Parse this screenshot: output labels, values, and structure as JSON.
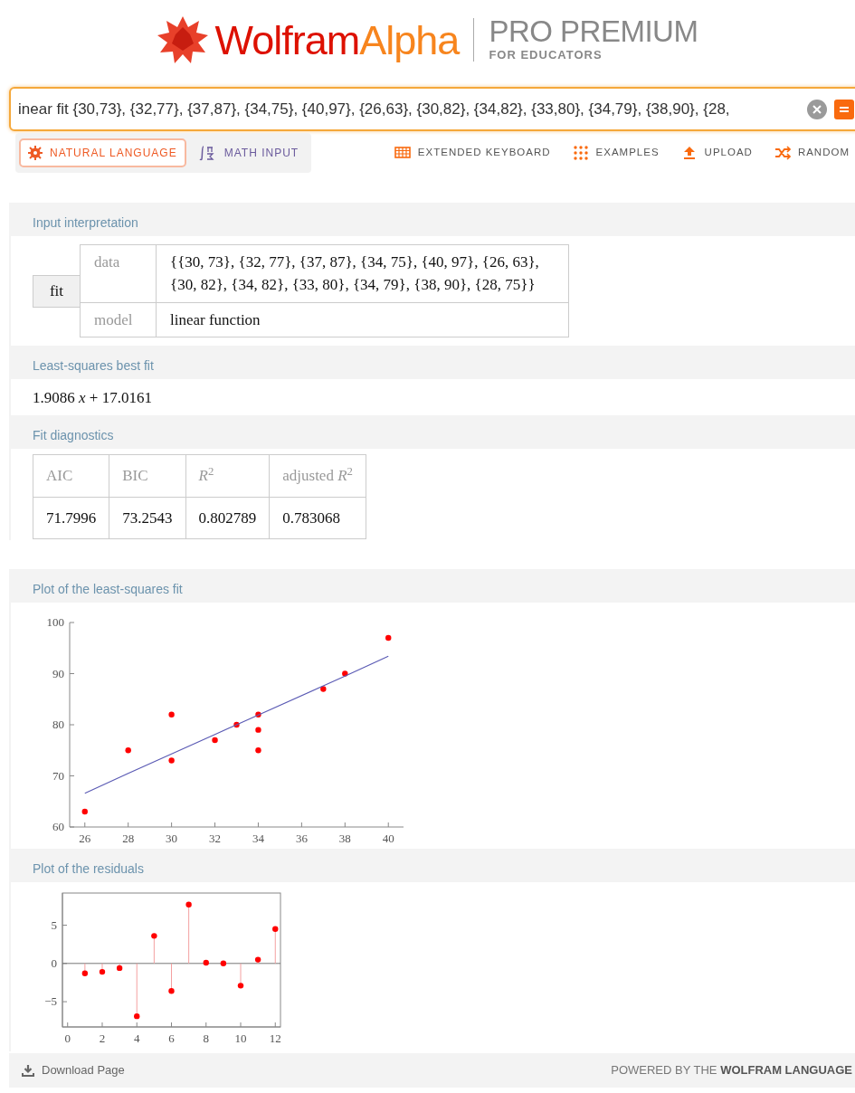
{
  "header": {
    "logo": {
      "first": "Wolfram",
      "second": "Alpha"
    },
    "edition": "PRO PREMIUM",
    "audience": "FOR EDUCATORS"
  },
  "search": {
    "value": "inear fit {30,73}, {32,77}, {37,87}, {34,75}, {40,97}, {26,63}, {30,82}, {34,82}, {33,80}, {34,79}, {38,90}, {28,"
  },
  "input_modes": [
    {
      "label": "NATURAL LANGUAGE",
      "selected": true
    },
    {
      "label": "MATH INPUT",
      "selected": false
    }
  ],
  "tools": [
    {
      "label": "EXTENDED KEYBOARD"
    },
    {
      "label": "EXAMPLES"
    },
    {
      "label": "UPLOAD"
    },
    {
      "label": "RANDOM"
    }
  ],
  "pod_groups": [
    {
      "pods": [
        {
          "kind": "interpretation",
          "title": "Input interpretation",
          "head": "fit",
          "rows": [
            {
              "label": "data",
              "value": "{{30, 73}, {32, 77}, {37, 87}, {34, 75}, {40, 97}, {26, 63}, {30, 82}, {34, 82}, {33, 80}, {34, 79}, {38, 90}, {28, 75}}"
            },
            {
              "label": "model",
              "value": "linear function"
            }
          ]
        },
        {
          "kind": "formula",
          "title": "Least-squares best fit",
          "text": "1.9086 *x* + 17.0161"
        },
        {
          "kind": "table",
          "title": "Fit diagnostics",
          "columns": [
            "AIC",
            "BIC",
            "*R*$^{2}$",
            "adjusted *R*$^{2}$"
          ],
          "rows": [
            [
              "71.7996",
              "73.2543",
              "0.802789",
              "0.783068"
            ]
          ]
        }
      ]
    },
    {
      "pods": [
        {
          "kind": "plot",
          "title": "Plot of the least-squares fit",
          "chart_data": {
            "type": "scatter",
            "x": [
              30,
              32,
              37,
              34,
              40,
              26,
              30,
              34,
              33,
              34,
              38,
              28
            ],
            "xlim": [
              25.3,
              40.7
            ],
            "ylim": [
              60,
              100
            ],
            "xticks": [
              26,
              28,
              30,
              32,
              34,
              36,
              38,
              40
            ],
            "yticks": [
              60,
              70,
              80,
              90,
              100
            ],
            "series": [
              {
                "color": "#ff0000",
                "values": [
                  73,
                  77,
                  87,
                  75,
                  97,
                  63,
                  82,
                  82,
                  80,
                  79,
                  90,
                  75
                ]
              },
              {
                "type": "line",
                "color": "#5a5ab4",
                "values": [
                  74.3,
                  78.1,
                  87.6,
                  81.9,
                  93.4,
                  66.6,
                  74.3,
                  81.9,
                  80.0,
                  81.9,
                  89.5,
                  70.5
                ]
              }
            ]
          }
        },
        {
          "kind": "plot",
          "title": "Plot of the residuals",
          "chart_data": {
            "type": "lollipop",
            "x": [
              1,
              2,
              3,
              4,
              5,
              6,
              7,
              8,
              9,
              10,
              11,
              12
            ],
            "xlim": [
              -0.3,
              12.3
            ],
            "ylim": [
              -8.3,
              9.2
            ],
            "xticks": [
              0,
              2,
              4,
              6,
              8,
              10,
              12
            ],
            "yticks": [
              {
                "value": -5,
                "label": "−5"
              },
              0,
              5
            ],
            "series": [
              {
                "color": "#ff0000",
                "values": [
                  -1.3,
                  -1.1,
                  -0.6,
                  -6.9,
                  3.6,
                  -3.6,
                  7.7,
                  0.1,
                  0.0,
                  -2.9,
                  0.5,
                  4.5
                ]
              }
            ]
          }
        }
      ]
    }
  ],
  "footer": {
    "download": "Download Page",
    "powered": "POWERED BY THE **WOLFRAM LANGUAGE**"
  }
}
